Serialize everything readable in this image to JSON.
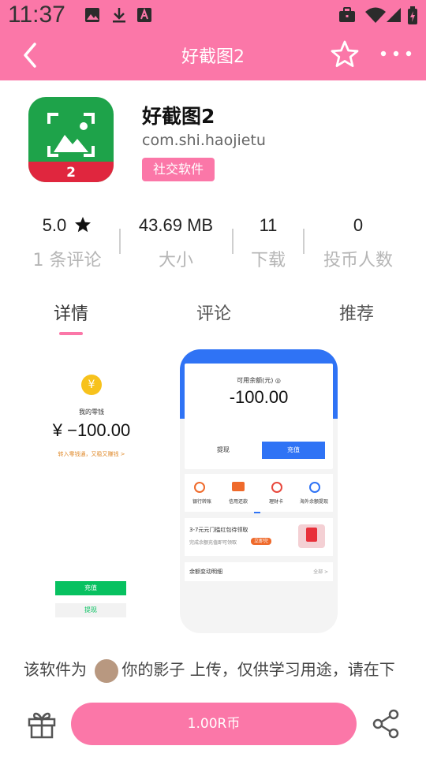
{
  "status_bar": {
    "time": "11:37",
    "icons": [
      "image-icon",
      "download-icon",
      "font-icon",
      "briefcase-icon",
      "wifi-icon",
      "signal-icon",
      "battery-icon"
    ]
  },
  "app_bar": {
    "title": "好截图2",
    "icons": [
      "back-arrow-icon",
      "star-outline-icon",
      "more-dots-icon"
    ]
  },
  "app": {
    "name": "好截图2",
    "package": "com.shi.haojietu",
    "category": "社交软件",
    "icon_badge": "2"
  },
  "stats": [
    {
      "value": "5.0",
      "label": "1 条评论",
      "icon": "star-icon"
    },
    {
      "value": "43.69 MB",
      "label": "大小"
    },
    {
      "value": "11",
      "label": "下载"
    },
    {
      "value": "0",
      "label": "投币人数"
    }
  ],
  "tabs": [
    {
      "label": "详情",
      "active": true
    },
    {
      "label": "评论",
      "active": false
    },
    {
      "label": "推荐",
      "active": false
    }
  ],
  "screenshot1": {
    "coin": "¥",
    "caption": "我的零钱",
    "amount": "¥ −100.00",
    "hint": "转入零钱通，又稳又赚钱 >",
    "btn_recharge": "充值",
    "btn_withdraw": "提现"
  },
  "screenshot2": {
    "balance_label": "可用余额(元) ◎",
    "balance": "-100.00",
    "btn_withdraw": "提现",
    "btn_recharge": "充值",
    "shortcuts": [
      "银行转账",
      "信用还款",
      "理财卡",
      "海外余额提现"
    ],
    "promo_title": "3-7元元门槛红包待领取",
    "promo_sub": "完成余额充值即可领取",
    "promo_btn": "立即完",
    "detail_label": "余额变动明细",
    "detail_more": "全部 >"
  },
  "description": {
    "prefix": "该软件为",
    "user": "你的影子",
    "suffix": "上传，仅供学习用途，请在下"
  },
  "bottom_bar": {
    "pay_label": "1.00R币",
    "icons": [
      "gift-icon",
      "share-icon"
    ]
  },
  "colors": {
    "accent": "#fb77a8",
    "app_icon_green": "#1ea34a",
    "app_icon_red": "#e0263e",
    "blue": "#2f73f5"
  }
}
